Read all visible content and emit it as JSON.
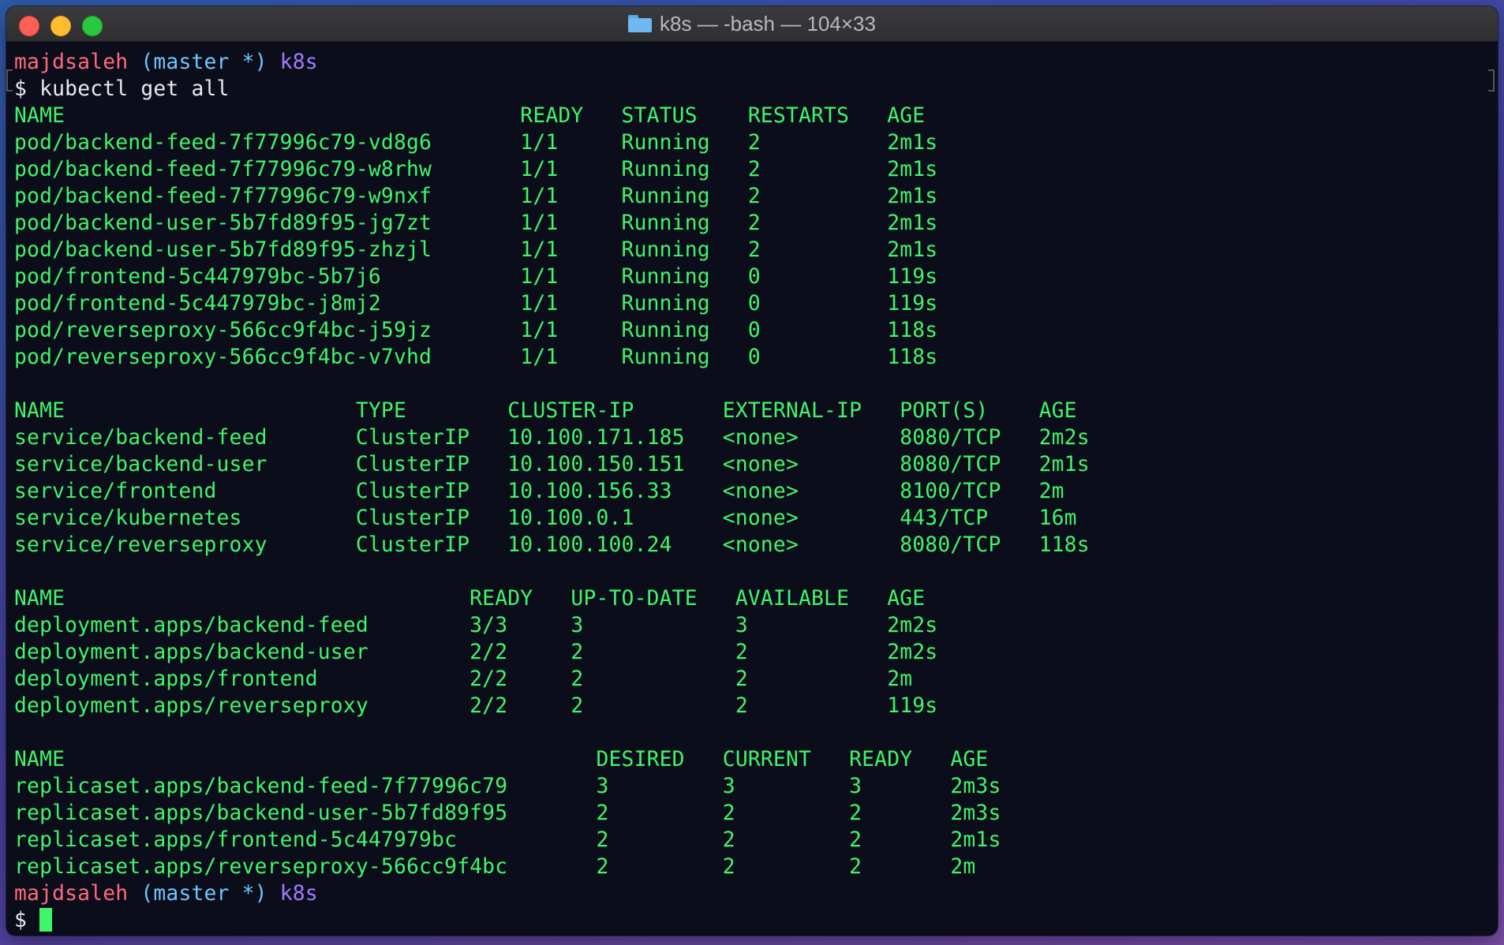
{
  "window": {
    "title": "k8s — -bash — 104×33"
  },
  "prompt1": {
    "user": "majdsaleh",
    "branch": "(master *)",
    "dir": "k8s"
  },
  "command": {
    "symbol": "$",
    "text": "kubectl get all"
  },
  "output_lines": [
    "NAME                                    READY   STATUS    RESTARTS   AGE",
    "pod/backend-feed-7f77996c79-vd8g6       1/1     Running   2          2m1s",
    "pod/backend-feed-7f77996c79-w8rhw       1/1     Running   2          2m1s",
    "pod/backend-feed-7f77996c79-w9nxf       1/1     Running   2          2m1s",
    "pod/backend-user-5b7fd89f95-jg7zt       1/1     Running   2          2m1s",
    "pod/backend-user-5b7fd89f95-zhzjl       1/1     Running   2          2m1s",
    "pod/frontend-5c447979bc-5b7j6           1/1     Running   0          119s",
    "pod/frontend-5c447979bc-j8mj2           1/1     Running   0          119s",
    "pod/reverseproxy-566cc9f4bc-j59jz       1/1     Running   0          118s",
    "pod/reverseproxy-566cc9f4bc-v7vhd       1/1     Running   0          118s",
    "",
    "NAME                       TYPE        CLUSTER-IP       EXTERNAL-IP   PORT(S)    AGE",
    "service/backend-feed       ClusterIP   10.100.171.185   <none>        8080/TCP   2m2s",
    "service/backend-user       ClusterIP   10.100.150.151   <none>        8080/TCP   2m1s",
    "service/frontend           ClusterIP   10.100.156.33    <none>        8100/TCP   2m",
    "service/kubernetes         ClusterIP   10.100.0.1       <none>        443/TCP    16m",
    "service/reverseproxy       ClusterIP   10.100.100.24    <none>        8080/TCP   118s",
    "",
    "NAME                                READY   UP-TO-DATE   AVAILABLE   AGE",
    "deployment.apps/backend-feed        3/3     3            3           2m2s",
    "deployment.apps/backend-user        2/2     2            2           2m2s",
    "deployment.apps/frontend            2/2     2            2           2m",
    "deployment.apps/reverseproxy        2/2     2            2           119s",
    "",
    "NAME                                          DESIRED   CURRENT   READY   AGE",
    "replicaset.apps/backend-feed-7f77996c79       3         3         3       2m3s",
    "replicaset.apps/backend-user-5b7fd89f95       2         2         2       2m3s",
    "replicaset.apps/frontend-5c447979bc           2         2         2       2m1s",
    "replicaset.apps/reverseproxy-566cc9f4bc       2         2         2       2m"
  ],
  "prompt2": {
    "user": "majdsaleh",
    "branch": "(master *)",
    "dir": "k8s"
  },
  "final_prompt": {
    "symbol": "$"
  }
}
